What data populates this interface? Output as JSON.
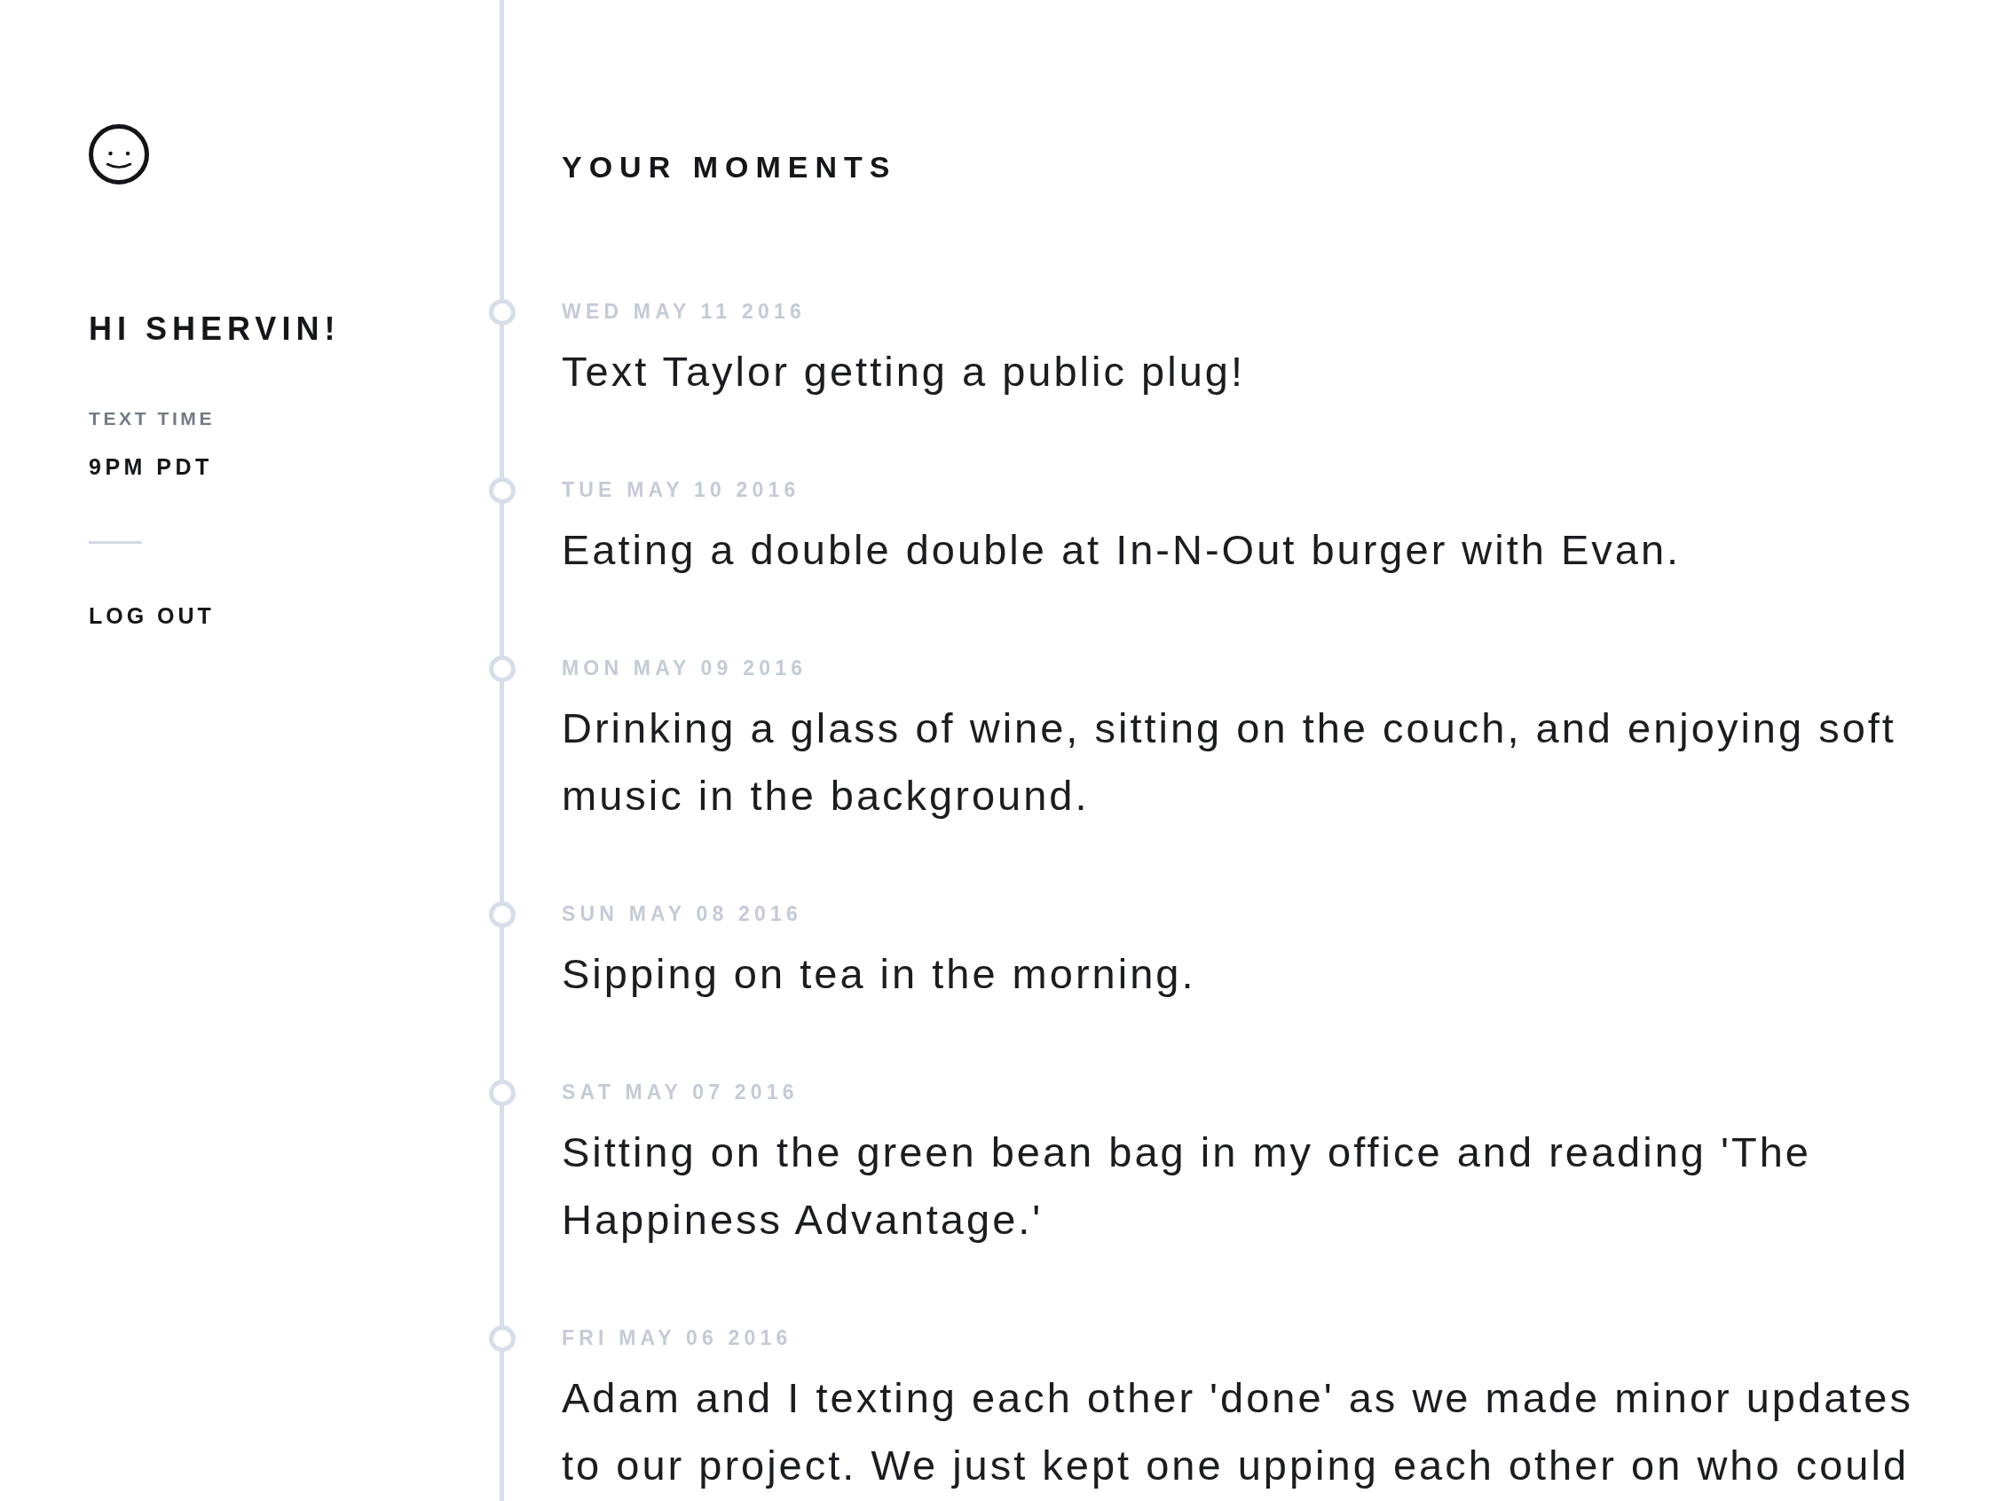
{
  "sidebar": {
    "greeting": "HI SHERVIN!",
    "text_time": {
      "label": "TEXT TIME",
      "value": "9PM PDT"
    },
    "logout": "LOG OUT"
  },
  "main": {
    "title": "YOUR MOMENTS",
    "moments": [
      {
        "date": "WED MAY 11 2016",
        "text": "Text Taylor getting a public plug!"
      },
      {
        "date": "TUE MAY 10 2016",
        "text": "Eating a double double at In-N-Out burger with Evan."
      },
      {
        "date": "MON MAY 09 2016",
        "text": "Drinking a glass of wine, sitting on the couch, and enjoying soft music in the background."
      },
      {
        "date": "SUN MAY 08 2016",
        "text": "Sipping on tea in the morning."
      },
      {
        "date": "SAT MAY 07 2016",
        "text": "Sitting on the green bean bag in my office and reading 'The Happiness Advantage.'"
      },
      {
        "date": "FRI MAY 06 2016",
        "text": "Adam and I texting each other 'done' as we made minor updates to our project. We just kept one upping each other on who could"
      }
    ]
  }
}
